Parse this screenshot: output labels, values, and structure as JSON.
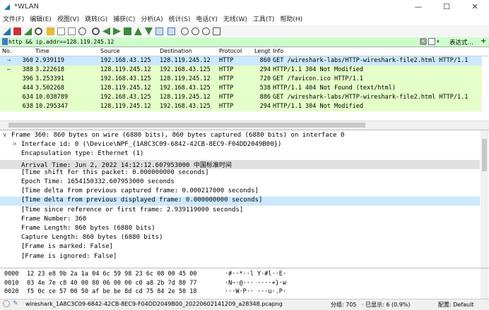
{
  "window": {
    "title": "*WLAN",
    "minimize": "—",
    "maximize": "☐",
    "close": "✕"
  },
  "menu": [
    "文件(F)",
    "编辑(E)",
    "视图(V)",
    "跳转(G)",
    "捕获(C)",
    "分析(A)",
    "统计(S)",
    "电话(Y)",
    "无线(W)",
    "工具(T)",
    "帮助(H)"
  ],
  "filter": {
    "value": "http && ip.addr==128.119.245.12",
    "expression_label": "表达式…",
    "plus": "+",
    "clear": "✕",
    "dropdown": "▾"
  },
  "packet_list": {
    "columns": [
      "No.",
      "Time",
      "Source",
      "Destination",
      "Protocol",
      "Lengt",
      "Info"
    ],
    "rows": [
      {
        "no": "360",
        "time": "2.939119",
        "src": "192.168.43.125",
        "dst": "128.119.245.12",
        "proto": "HTTP",
        "len": "860",
        "info": "GET /wireshark-labs/HTTP-wireshark-file2.html HTTP/1.1",
        "marker": "→"
      },
      {
        "no": "388",
        "time": "3.222618",
        "src": "128.119.245.12",
        "dst": "192.168.43.125",
        "proto": "HTTP",
        "len": "294",
        "info": "HTTP/1.1 304 Not Modified",
        "marker": "←"
      },
      {
        "no": "396",
        "time": "3.253391",
        "src": "192.168.43.125",
        "dst": "128.119.245.12",
        "proto": "HTTP",
        "len": "720",
        "info": "GET /favicon.ico HTTP/1.1",
        "marker": ""
      },
      {
        "no": "444",
        "time": "3.502268",
        "src": "128.119.245.12",
        "dst": "192.168.43.125",
        "proto": "HTTP",
        "len": "538",
        "info": "HTTP/1.1 404 Not Found  (text/html)",
        "marker": ""
      },
      {
        "no": "634",
        "time": "10.038789",
        "src": "192.168.43.125",
        "dst": "128.119.245.12",
        "proto": "HTTP",
        "len": "886",
        "info": "GET /wireshark-labs/HTTP-wireshark-file2.html HTTP/1.1",
        "marker": ""
      },
      {
        "no": "638",
        "time": "10.295347",
        "src": "128.119.245.12",
        "dst": "192.168.43.125",
        "proto": "HTTP",
        "len": "294",
        "info": "HTTP/1.1 304 Not Modified",
        "marker": ""
      }
    ]
  },
  "details": {
    "lines": [
      {
        "text": "Frame 360: 860 bytes on wire (6880 bits), 860 bytes captured (6880 bits) on interface 0",
        "expander": "∨"
      },
      {
        "text": "Interface id: 0 (\\Device\\NPF_{1A8C3C09-6842-42CB-8EC9-F04DD2049B00})",
        "expander": ">"
      },
      {
        "text": "Encapsulation type: Ethernet (1)",
        "expander": ""
      },
      {
        "text": "Arrival Time: Jun  2, 2022 14:12:12.607953000 中国标准时间",
        "expander": ""
      },
      {
        "text": "[Time shift for this packet: 0.000000000 seconds]",
        "expander": ""
      },
      {
        "text": "Epoch Time: 1654150332.607953000 seconds",
        "expander": ""
      },
      {
        "text": "[Time delta from previous captured frame: 0.000217000 seconds]",
        "expander": ""
      },
      {
        "text": "[Time delta from previous displayed frame: 0.000000000 seconds]",
        "expander": ""
      },
      {
        "text": "[Time since reference or first frame: 2.939119000 seconds]",
        "expander": ""
      },
      {
        "text": "Frame Number: 360",
        "expander": ""
      },
      {
        "text": "Frame Length: 860 bytes (6880 bits)",
        "expander": ""
      },
      {
        "text": "Capture Length: 860 bytes (6880 bits)",
        "expander": ""
      },
      {
        "text": "[Frame is marked: False]",
        "expander": ""
      },
      {
        "text": "[Frame is ignored: False]",
        "expander": ""
      }
    ]
  },
  "bytes": [
    {
      "offset": "0000",
      "hex": "12 23 e8 9b 2a 1a 04 6c  59 98 23 6c 08 00 45 00",
      "ascii": "·#··*··l Y·#l··E·"
    },
    {
      "offset": "0010",
      "hex": "03 4e 7e c8 40 00 80 06  00 00 c0 a8 2b 7d 80 77",
      "ascii": "·N~·@··· ····+}·w"
    },
    {
      "offset": "0020",
      "hex": "f5 0c ce 57 00 50 af be  be 8d cd 75 84 2e 50 18",
      "ascii": "···W·P·· ···u·.P·"
    }
  ],
  "status": {
    "file": "wireshark_1A8C3C09-6842-42CB-8EC9-F04DD2049B00_20220602141209_a28348.pcapng",
    "groups": "分组: 705",
    "displayed": "· 已显示: 6 (0.9%)",
    "profile": "配置: Default"
  },
  "colors": {
    "http_row": "#e4ffc7",
    "selected_row": "#cce8ff",
    "filter_ok": "#ccffcc",
    "highlight_line": "#cce8ff",
    "gray_line": "#e0e0e0"
  }
}
